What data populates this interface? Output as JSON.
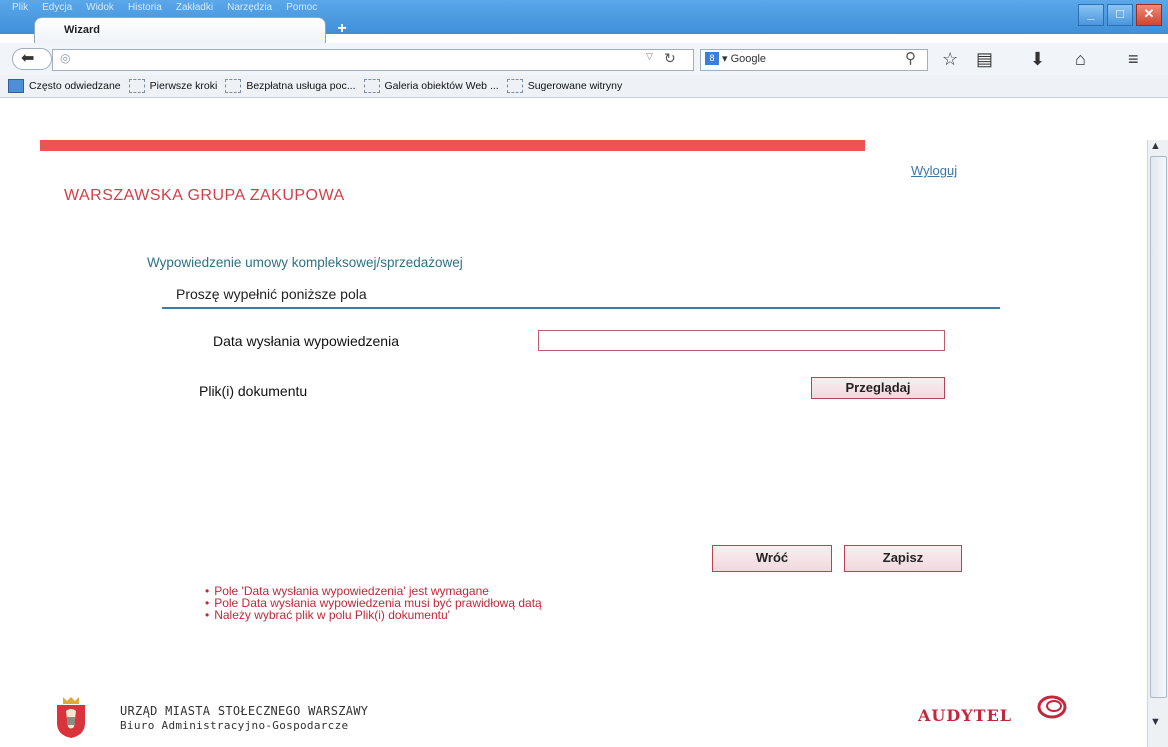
{
  "menu": [
    "Plik",
    "Edycja",
    "Widok",
    "Historia",
    "Zakładki",
    "Narzędzia",
    "Pomoc"
  ],
  "tab": {
    "title": "Wizard",
    "new_tab": "+"
  },
  "search": {
    "engine": "Google"
  },
  "bookmarks": [
    "Często odwiedzane",
    "Pierwsze kroki",
    "Bezpłatna usługa poc...",
    "Galeria obiektów Web ...",
    "Sugerowane witryny"
  ],
  "page": {
    "logout": "Wyloguj",
    "brand": "WARSZAWSKA GRUPA ZAKUPOWA",
    "section_title": "Wypowiedzenie umowy kompleksowej/sprzedażowej",
    "form_header": "Proszę wypełnić poniższe pola",
    "date_label": "Data wysłania wypowiedzenia",
    "date_value": "",
    "file_label": "Plik(i) dokumentu",
    "browse_button": "Przeglądaj",
    "back_button": "Wróć",
    "save_button": "Zapisz",
    "errors": [
      "Pole 'Data wysłania wypowiedzenia' jest wymagane",
      "Pole Data wysłania wypowiedzenia musi być prawidłową datą",
      "Należy wybrać plik w polu Plik(i) dokumentu'"
    ]
  },
  "footer": {
    "city": "URZĄD MIASTA STOŁECZNEGO WARSZAWY",
    "department": "Biuro Administracyjno-Gospodarcze",
    "partner_logo": "AUDYTEL"
  },
  "colors": {
    "accent_red": "#d43f47",
    "error_red": "#c0283a",
    "link_blue": "#3b74a8",
    "titlebar_blue": "#3f8fd8"
  }
}
